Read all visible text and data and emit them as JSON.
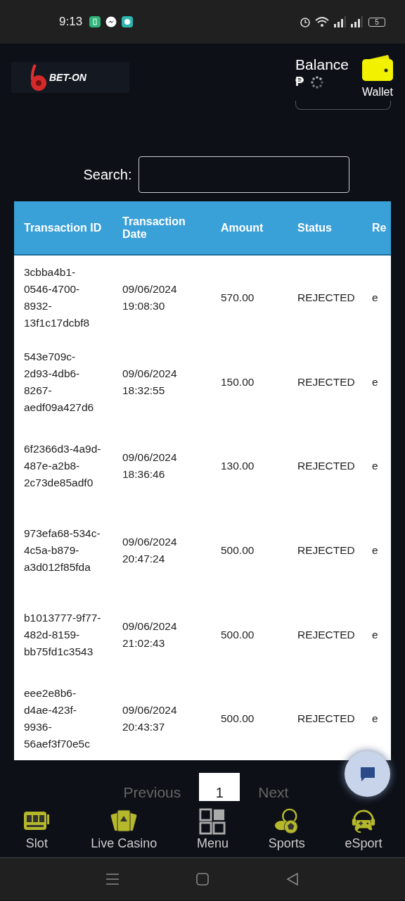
{
  "status_bar": {
    "time": "9:13",
    "battery": "5"
  },
  "header": {
    "logo": "BET-ON",
    "balance_label": "Balance",
    "currency": "₱",
    "wallet_label": "Wallet"
  },
  "search": {
    "label": "Search:"
  },
  "table": {
    "columns": [
      {
        "label": "Transaction ID"
      },
      {
        "label": "Transaction Date"
      },
      {
        "label": "Amount"
      },
      {
        "label": "Status"
      },
      {
        "label": "Re"
      }
    ],
    "rows": [
      {
        "id": "3cbba4b1-0546-4700-8932-13f1c17dcbf8",
        "date": "09/06/2024 19:08:30",
        "amount": "570.00",
        "status": "REJECTED",
        "column_5": "e"
      },
      {
        "id": "543e709c-2d93-4db6-8267-aedf09a427d6",
        "date": "09/06/2024 18:32:55",
        "amount": "150.00",
        "status": "REJECTED",
        "column_5": "e"
      },
      {
        "id": "6f2366d3-4a9d-487e-a2b8-2c73de85adf0",
        "date": "09/06/2024 18:36:46",
        "amount": "130.00",
        "status": "REJECTED",
        "column_5": "e"
      },
      {
        "id": "973efa68-534c-4c5a-b879-a3d012f85fda",
        "date": "09/06/2024 20:47:24",
        "amount": "500.00",
        "status": "REJECTED",
        "column_5": "e"
      },
      {
        "id": "b1013777-9f77-482d-8159-bb75fd1c3543",
        "date": "09/06/2024 21:02:43",
        "amount": "500.00",
        "status": "REJECTED",
        "column_5": "e"
      },
      {
        "id": "eee2e8b6-d4ae-423f-9936-56aef3f70e5c",
        "date": "09/06/2024 20:43:37",
        "amount": "500.00",
        "status": "REJECTED",
        "column_5": "e"
      }
    ]
  },
  "pagination": {
    "previous": "Previous",
    "pages": [
      {
        "label": "1",
        "selected": true
      }
    ],
    "next": "Next"
  },
  "bottom_nav": [
    {
      "label": "Slot",
      "kind": "slot"
    },
    {
      "label": "Live Casino",
      "kind": "cards"
    },
    {
      "label": "Menu",
      "kind": "menu"
    },
    {
      "label": "Sports",
      "kind": "sports"
    },
    {
      "label": "eSport",
      "kind": "esport"
    }
  ]
}
